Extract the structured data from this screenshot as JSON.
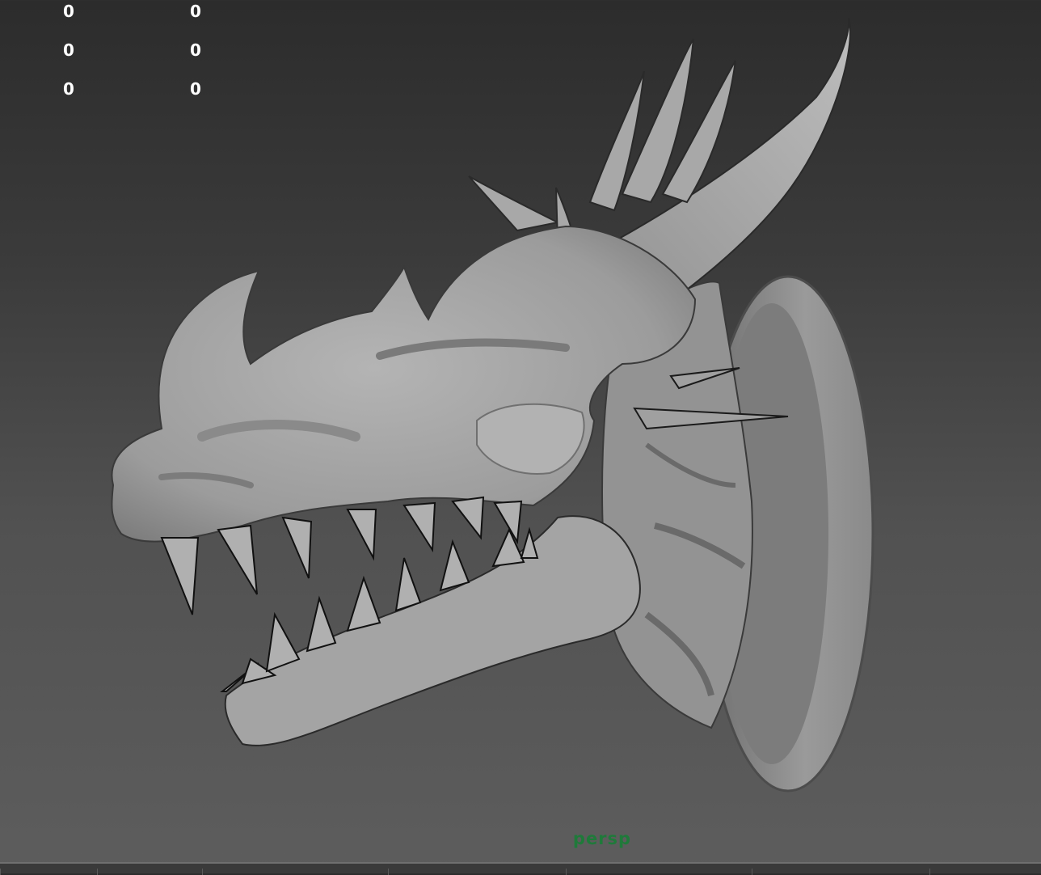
{
  "viewport": {
    "hud_rows": [
      [
        "0",
        "0"
      ],
      [
        "0",
        "0"
      ],
      [
        "0",
        "0"
      ]
    ],
    "camera_label": "persp",
    "camera_label_color": "#1f7a3a",
    "model_color": "#a6a6a6"
  }
}
